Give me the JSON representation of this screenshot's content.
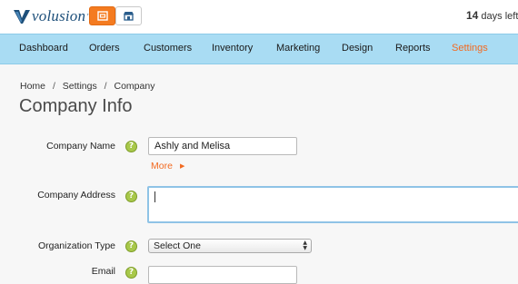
{
  "brand": {
    "name": "volusion",
    "tm": "™"
  },
  "store_buttons": [
    {
      "icon": "store-icon",
      "active": true
    },
    {
      "icon": "storefront-icon",
      "active": false
    }
  ],
  "trial": {
    "days": "14",
    "suffix": "days left i"
  },
  "nav": {
    "items": [
      {
        "label": "Dashboard"
      },
      {
        "label": "Orders"
      },
      {
        "label": "Customers"
      },
      {
        "label": "Inventory"
      },
      {
        "label": "Marketing"
      },
      {
        "label": "Design"
      },
      {
        "label": "Reports"
      },
      {
        "label": "Settings",
        "active": true
      }
    ]
  },
  "breadcrumb": {
    "items": [
      "Home",
      "Settings",
      "Company"
    ],
    "separator": "/"
  },
  "page": {
    "title": "Company Info"
  },
  "form": {
    "company_name": {
      "label": "Company Name",
      "value": "Ashly and Melisa"
    },
    "more": {
      "label": "More",
      "arrow": "▶"
    },
    "company_address": {
      "label": "Company Address",
      "value": ""
    },
    "organization_type": {
      "label": "Organization Type",
      "selected": "Select One"
    },
    "email": {
      "label": "Email"
    },
    "help_glyph": "?"
  },
  "colors": {
    "accent": "#f26a21",
    "nav_bg": "#a9dcf3",
    "help_green": "#a8c84a",
    "brand_blue": "#1d4f7a"
  }
}
